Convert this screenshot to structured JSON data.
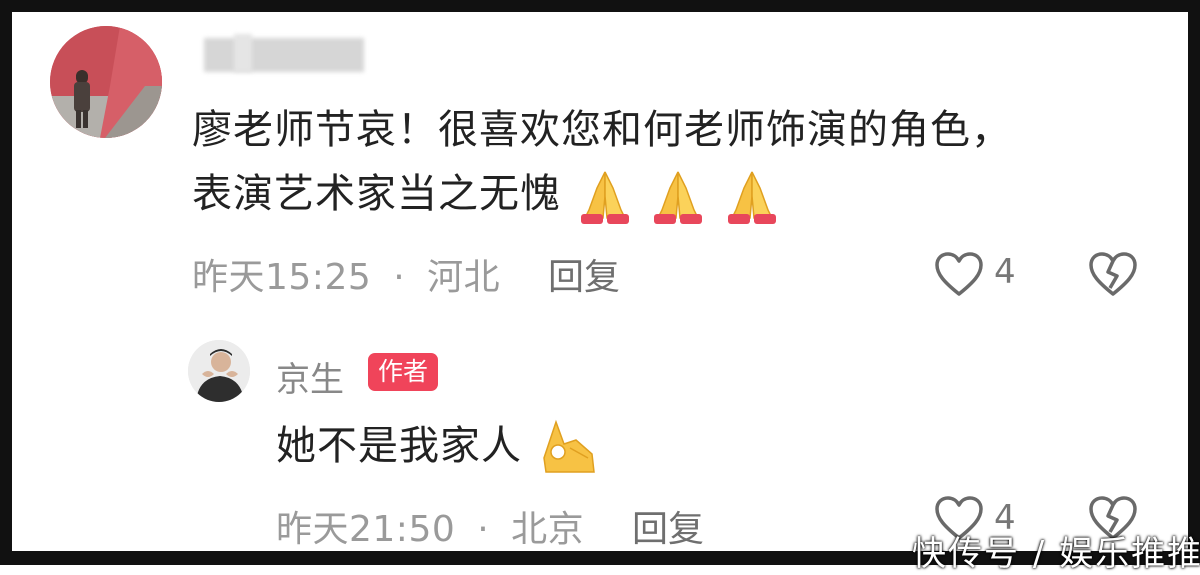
{
  "comment": {
    "text_line1": "廖老师节哀！很喜欢您和何老师饰演的角色，",
    "text_line2": "表演艺术家当之无愧",
    "emoji_icons": [
      "praying-hands-icon",
      "praying-hands-icon",
      "praying-hands-icon"
    ],
    "time": "昨天15:25",
    "separator": "·",
    "location": "河北",
    "reply_label": "回复",
    "like_count": "4"
  },
  "reply": {
    "username": "京生",
    "author_badge": "作者",
    "text": "她不是我家人",
    "emoji_icon": "ok-hand-icon",
    "time": "昨天21:50",
    "separator": "·",
    "location": "北京",
    "reply_label": "回复",
    "like_count": "4"
  },
  "watermark": "快传号 / 娱乐推推",
  "colors": {
    "badge": "#f0445a",
    "meta_text": "#9a9a9a",
    "body_text": "#222222",
    "frame": "#111111"
  }
}
